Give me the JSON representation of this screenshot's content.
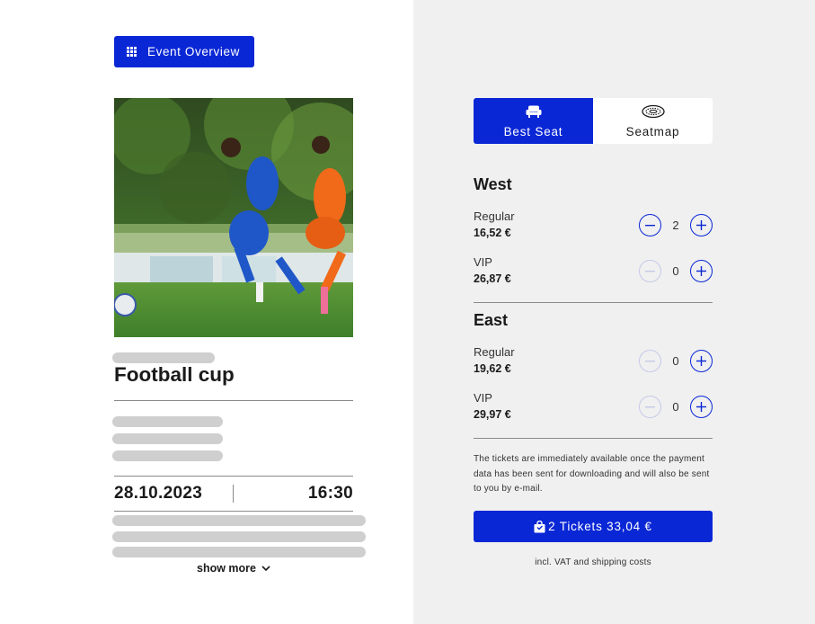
{
  "overview_button": {
    "label": "Event Overview",
    "icon": "grid-icon"
  },
  "event": {
    "title": "Football cup",
    "date": "28.10.2023",
    "time": "16:30",
    "image": "football-players-photo"
  },
  "show_more": {
    "label": "show more",
    "icon": "chevron-down-icon"
  },
  "tabs": [
    {
      "label": "Best Seat",
      "icon": "seat-icon",
      "active": true
    },
    {
      "label": "Seatmap",
      "icon": "stadium-icon",
      "active": false
    }
  ],
  "sections": [
    {
      "name": "West",
      "tiers": [
        {
          "name": "Regular",
          "price": "16,52 €",
          "qty": "2"
        },
        {
          "name": "VIP",
          "price": "26,87 €",
          "qty": "0"
        }
      ]
    },
    {
      "name": "East",
      "tiers": [
        {
          "name": "Regular",
          "price": "19,62 €",
          "qty": "0"
        },
        {
          "name": "VIP",
          "price": "29,97 €",
          "qty": "0"
        }
      ]
    }
  ],
  "info_text": "The tickets are immediately available once the payment data has been sent for downloading and will also be sent to you by e-mail.",
  "cta": {
    "label": "2 Tickets 33,04 €",
    "icon": "shopping-bag-icon"
  },
  "vat_note": "incl. VAT and shipping costs",
  "colors": {
    "accent": "#0a27d6",
    "panel_bg": "#f0f0f0",
    "skeleton": "#cfcfcf"
  }
}
